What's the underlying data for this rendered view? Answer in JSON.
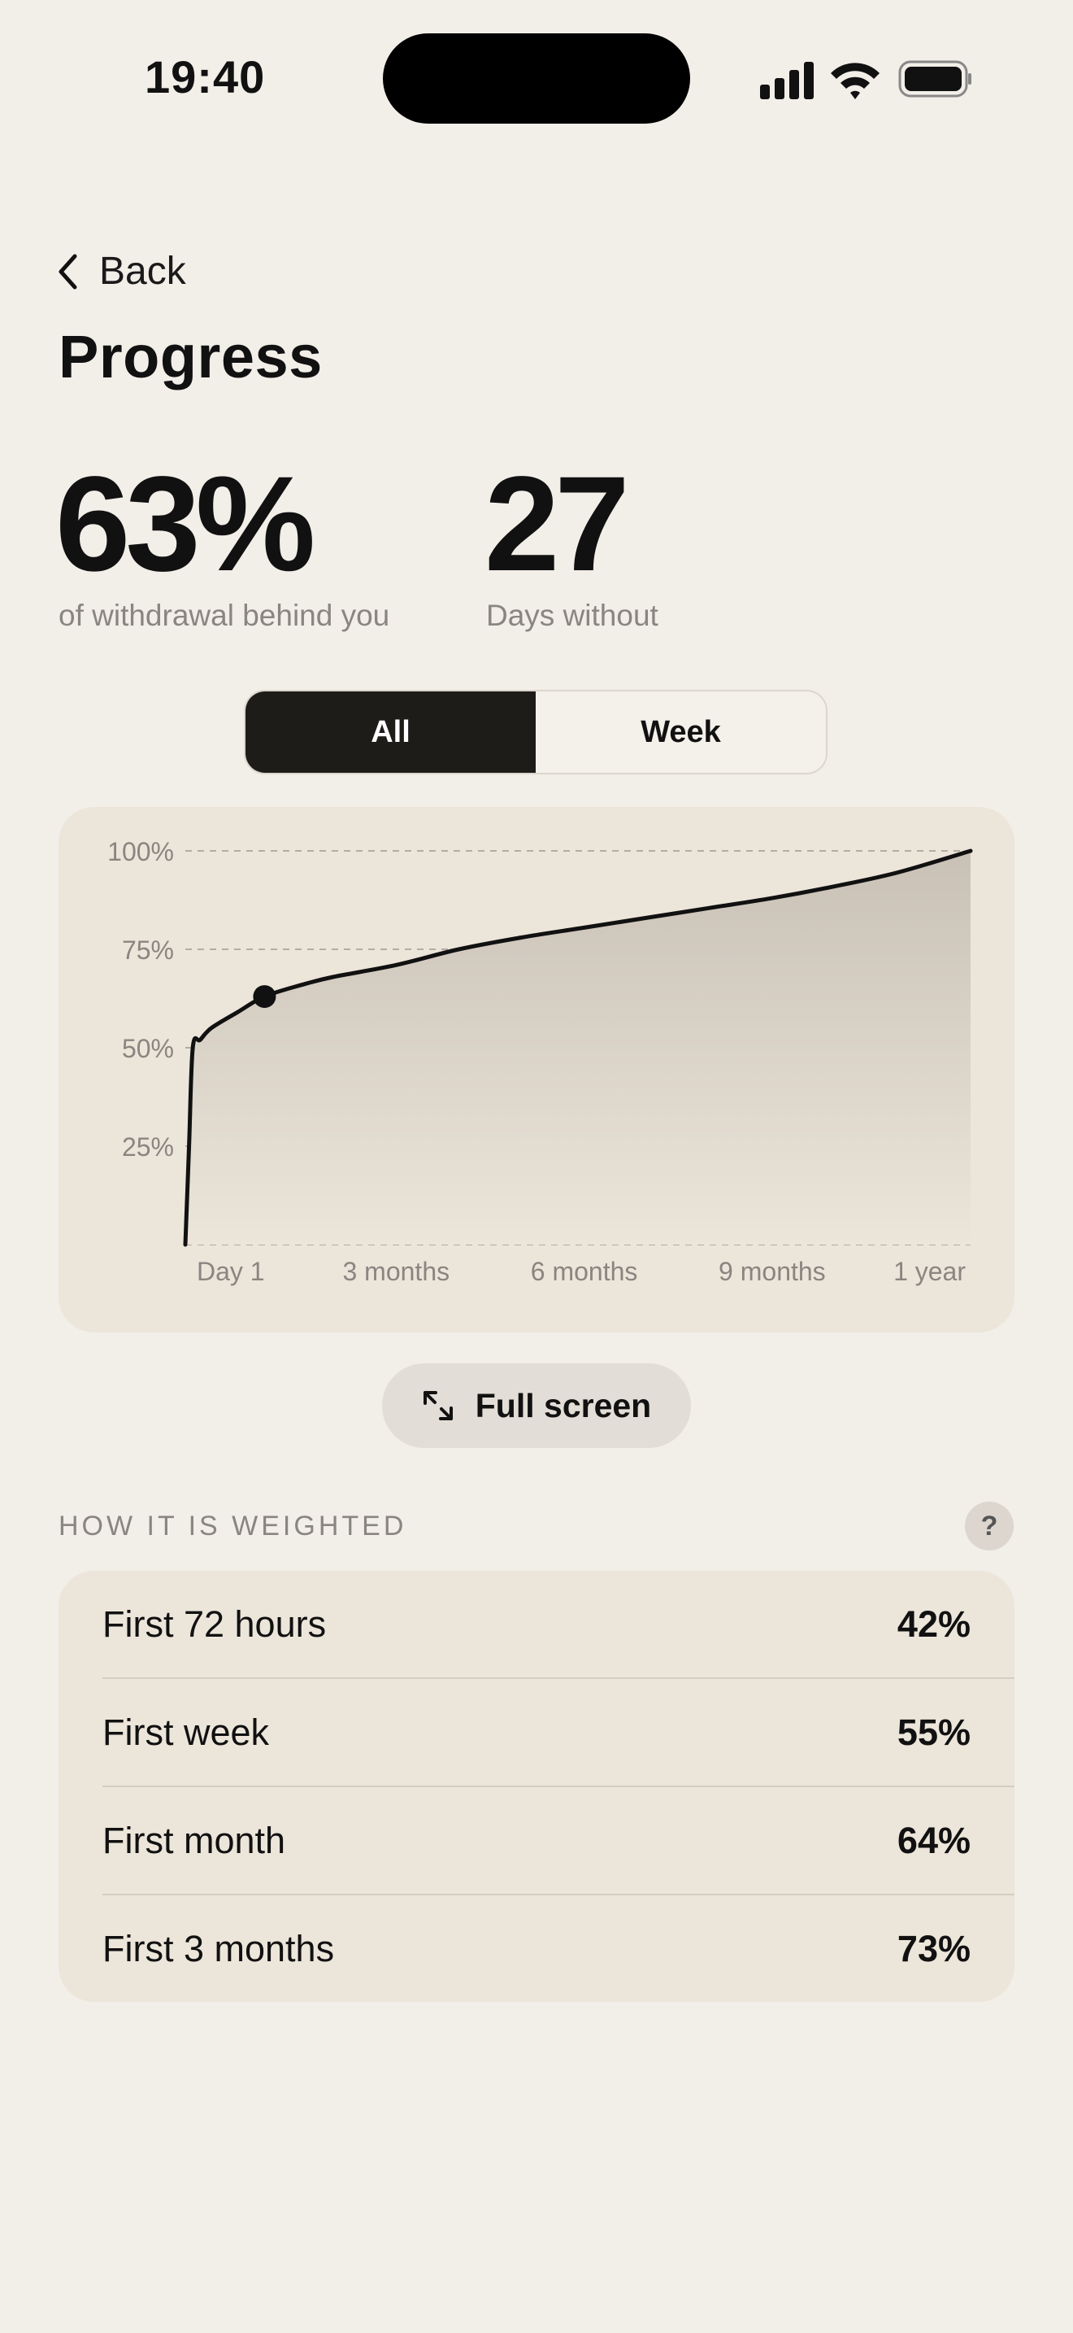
{
  "status_bar": {
    "time": "19:40"
  },
  "header": {
    "back_label": "Back",
    "title": "Progress"
  },
  "stats": [
    {
      "value": "63%",
      "label": "of withdrawal behind you"
    },
    {
      "value": "27",
      "label": "Days without"
    }
  ],
  "segmented": {
    "options": [
      "All",
      "Week"
    ],
    "selected": "All"
  },
  "chart_data": {
    "type": "area",
    "x_ticks": [
      "Day 1",
      "3 months",
      "6 months",
      "9 months",
      "1 year"
    ],
    "y_ticks": [
      "100%",
      "75%",
      "50%",
      "25%"
    ],
    "ylim": [
      0,
      100
    ],
    "grid": true,
    "series": [
      {
        "x": [
          0,
          1,
          2,
          4,
          7,
          14,
          27,
          45,
          60,
          90,
          120,
          150,
          180,
          210,
          240,
          270,
          300,
          330,
          365
        ],
        "y": [
          0,
          25,
          50,
          52,
          55,
          59,
          63,
          66,
          68,
          71,
          75,
          78,
          80.5,
          83,
          85.5,
          88,
          91,
          94.5,
          100
        ]
      }
    ],
    "current_marker": {
      "x": 27,
      "y": 63
    }
  },
  "full_screen": {
    "label": "Full screen"
  },
  "weighted": {
    "title": "HOW IT IS WEIGHTED",
    "help_label": "?",
    "rows": [
      {
        "label": "First 72 hours",
        "value": "42%"
      },
      {
        "label": "First week",
        "value": "55%"
      },
      {
        "label": "First month",
        "value": "64%"
      },
      {
        "label": "First 3 months",
        "value": "73%"
      }
    ]
  },
  "colors": {
    "background": "#f2eee8",
    "card": "#ece5da",
    "accent_dark": "#1e1c19",
    "muted_text": "#8a8580"
  }
}
